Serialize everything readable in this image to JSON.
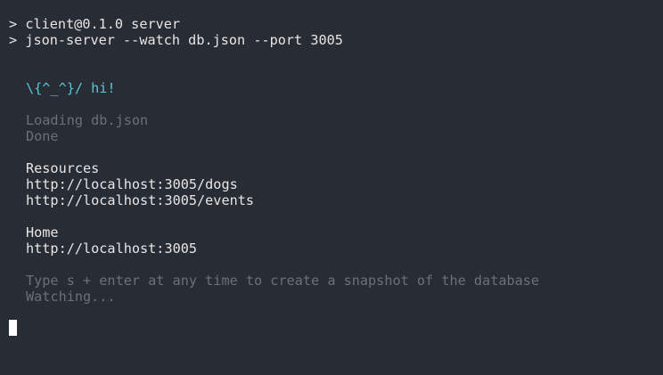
{
  "terminal": {
    "prompt_symbol": ">",
    "cmd1": "client@0.1.0 server",
    "cmd2": "json-server --watch db.json --port 3005",
    "greeting": "\\{^_^}/ hi!",
    "loading": "Loading db.json",
    "done": "Done",
    "resources_header": "Resources",
    "resources": [
      "http://localhost:3005/dogs",
      "http://localhost:3005/events"
    ],
    "home_header": "Home",
    "home_url": "http://localhost:3005",
    "snapshot_hint": "Type s + enter at any time to create a snapshot of the database",
    "watching": "Watching..."
  },
  "colors": {
    "background": "#282c34",
    "text": "#e6e6e6",
    "accent_cyan": "#56c8d8",
    "dim_text": "#6b7079",
    "cursor": "#ffffff"
  }
}
